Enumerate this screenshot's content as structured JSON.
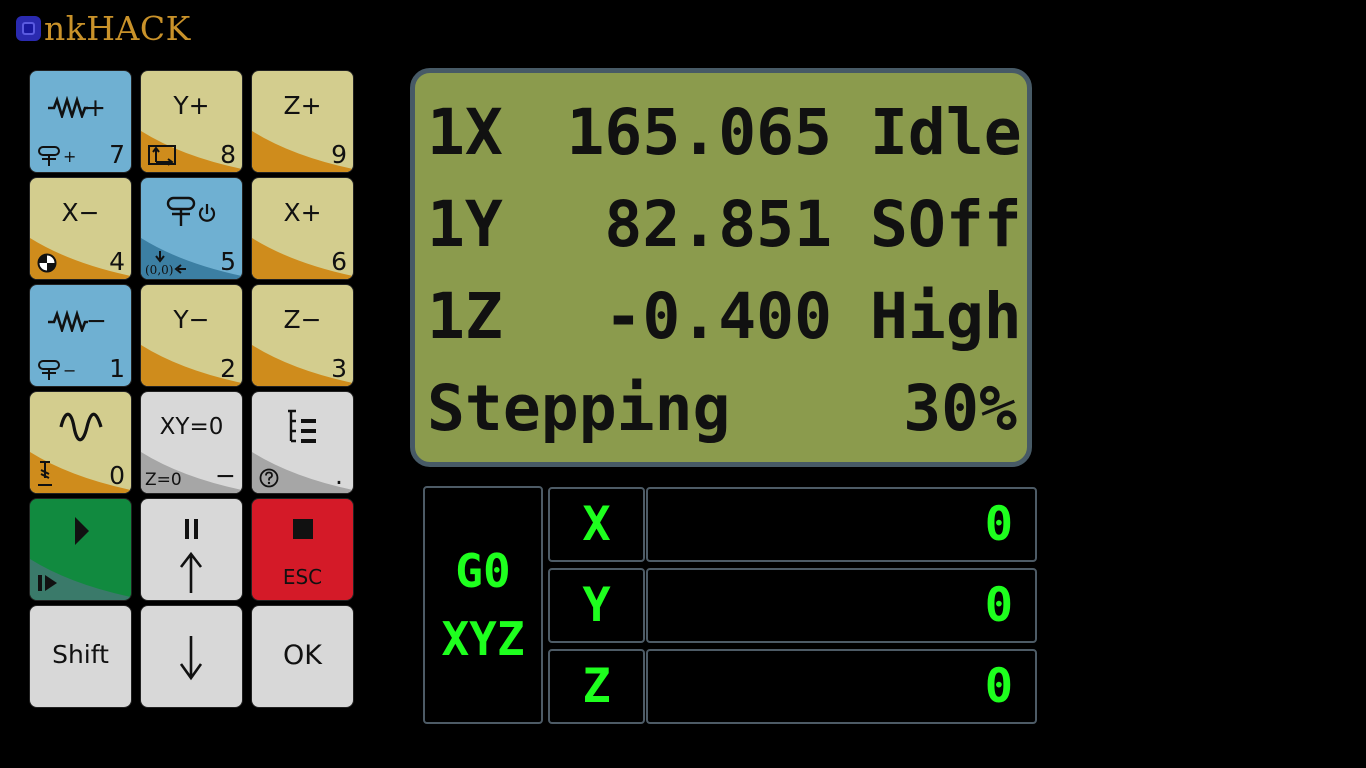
{
  "app": {
    "logo_text": "nkHACK"
  },
  "keypad": {
    "feed_up": {
      "num": "7",
      "main": "+",
      "sub": "+"
    },
    "y_plus": {
      "main": "Y+",
      "num": "8"
    },
    "z_plus": {
      "main": "Z+",
      "num": "9"
    },
    "x_minus": {
      "main": "X−",
      "num": "4"
    },
    "spindle": {
      "num": "5",
      "sub": "(0,0)"
    },
    "x_plus": {
      "main": "X+",
      "num": "6"
    },
    "feed_down": {
      "num": "1",
      "main": "−",
      "sub": "−"
    },
    "y_minus": {
      "main": "Y−",
      "num": "2"
    },
    "z_minus": {
      "main": "Z−",
      "num": "3"
    },
    "mode": {
      "num": "0"
    },
    "zero": {
      "main": "XY=0",
      "sub": "Z=0",
      "num": "−"
    },
    "menu": {
      "num": "."
    },
    "run": {},
    "pause": {
      "main": "II"
    },
    "esc": {
      "main": "ESC"
    },
    "shift": {
      "main": "Shift"
    },
    "down": {},
    "ok": {
      "main": "OK"
    }
  },
  "lcd": {
    "rows": [
      {
        "c1": "1X",
        "c2": "165.065",
        "c3": "Idle"
      },
      {
        "c1": "1Y",
        "c2": "82.851",
        "c3": "SOff"
      },
      {
        "c1": "1Z",
        "c2": "-0.400",
        "c3": "High"
      },
      {
        "c1": "Stepping",
        "c3": "30%"
      }
    ]
  },
  "coords": {
    "mode_line1": "G0",
    "mode_line2": "XYZ",
    "axes": [
      {
        "label": "X",
        "value": "0"
      },
      {
        "label": "Y",
        "value": "0"
      },
      {
        "label": "Z",
        "value": "0"
      }
    ]
  },
  "colors": {
    "key_blue": "#6fb0d2",
    "key_yellow": "#d3cd8e",
    "key_orange": "#cf8c1c",
    "key_gray": "#d8d8d8",
    "key_green": "#118a3f",
    "key_red": "#d41a28",
    "lcd_bg": "#8b9b4d",
    "digit_green": "#1eff1e"
  }
}
